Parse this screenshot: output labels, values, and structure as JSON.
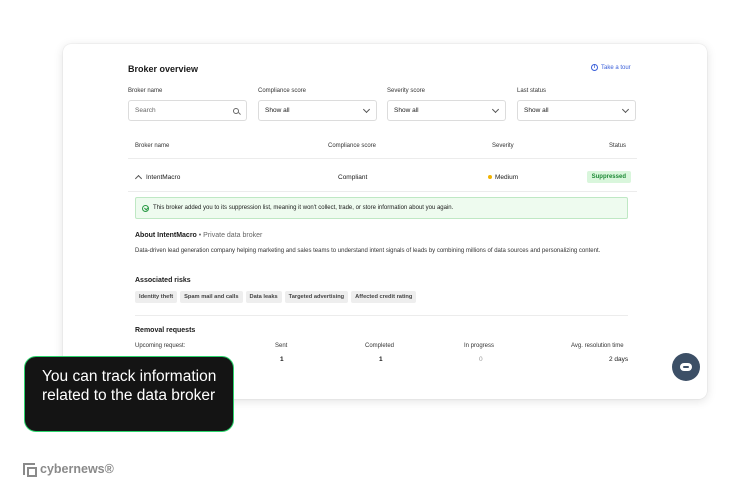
{
  "header": {
    "title": "Broker overview",
    "tour_label": "Take a tour"
  },
  "filters": [
    {
      "label": "Broker name",
      "value": "Search",
      "type": "search"
    },
    {
      "label": "Compliance score",
      "value": "Show all",
      "type": "select"
    },
    {
      "label": "Severity score",
      "value": "Show all",
      "type": "select"
    },
    {
      "label": "Last status",
      "value": "Show all",
      "type": "select"
    }
  ],
  "table": {
    "headers": [
      "Broker name",
      "Compliance score",
      "Severity",
      "Status"
    ],
    "row": {
      "name": "IntentMacro",
      "compliance": "Compliant",
      "severity": "Medium",
      "status": "Suppressed"
    }
  },
  "notice": "This broker added you to its suppression list, meaning it won't collect, trade, or store information about you again.",
  "about": {
    "title": "About IntentMacro",
    "subtitle": "• Private data broker",
    "description": "Data-driven lead generation company helping marketing and sales teams to understand intent signals of leads by combining millions of data sources and personalizing content."
  },
  "risks": {
    "title": "Associated risks",
    "tags": [
      "Identity theft",
      "Spam mail and calls",
      "Data leaks",
      "Targeted advertising",
      "Affected credit rating"
    ]
  },
  "removal": {
    "title": "Removal requests",
    "stats": [
      {
        "label": "Upcoming request:",
        "value": ""
      },
      {
        "label": "Sent",
        "value": "1"
      },
      {
        "label": "Completed",
        "value": "1"
      },
      {
        "label": "In progress",
        "value": "0"
      },
      {
        "label": "Avg. resolution time",
        "value": "2 days"
      }
    ]
  },
  "callout": "You can track information related to the data broker",
  "brand": "cybernews®",
  "colors": {
    "accent": "#3a5fd9",
    "success": "#1e8a36",
    "callout_border": "#2bd46b",
    "severity_medium": "#f1b300"
  },
  "icons": [
    "info-icon",
    "search-icon",
    "chevron-down-icon",
    "chevron-up-icon",
    "check-circle-icon",
    "chat-icon",
    "cybernews-logo-icon"
  ]
}
